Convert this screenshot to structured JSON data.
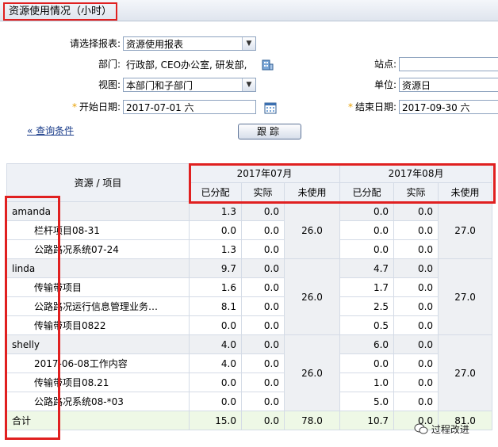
{
  "title": "资源使用情况（小时）",
  "form": {
    "report_label": "请选择报表:",
    "report_value": "资源使用报表",
    "dept_label": "部门:",
    "dept_value": "行政部, CEO办公室, 研发部,",
    "site_label": "站点:",
    "site_value": "",
    "view_label": "视图:",
    "view_value": "本部门和子部门",
    "unit_label": "单位:",
    "unit_value": "资源日",
    "start_label": "开始日期:",
    "start_value": "2017-07-01 六",
    "end_label": "结束日期:",
    "end_value": "2017-09-30 六",
    "query_link": "« 查询条件",
    "track_button": "跟踪"
  },
  "table": {
    "resource_header": "资源 / 项目",
    "months": [
      "2017年07月",
      "2017年08月"
    ],
    "sub_headers": [
      "已分配",
      "实际",
      "未使用"
    ],
    "groups": [
      {
        "name": "amanda",
        "totals": [
          "1.3",
          "0.0",
          "0.0",
          "0.0"
        ],
        "unused": [
          "26.0",
          "27.0"
        ],
        "items": [
          {
            "name": "栏杆项目08-31",
            "values": [
              "0.0",
              "0.0",
              "0.0",
              "0.0"
            ]
          },
          {
            "name": "公路路况系统07-24",
            "values": [
              "1.3",
              "0.0",
              "0.0",
              "0.0"
            ]
          }
        ]
      },
      {
        "name": "linda",
        "totals": [
          "9.7",
          "0.0",
          "4.7",
          "0.0"
        ],
        "unused": [
          "26.0",
          "27.0"
        ],
        "items": [
          {
            "name": "传输带项目",
            "values": [
              "1.6",
              "0.0",
              "1.7",
              "0.0"
            ]
          },
          {
            "name": "公路路况运行信息管理业务…",
            "values": [
              "8.1",
              "0.0",
              "2.5",
              "0.0"
            ]
          },
          {
            "name": "传输带项目0822",
            "values": [
              "0.0",
              "0.0",
              "0.5",
              "0.0"
            ]
          }
        ]
      },
      {
        "name": "shelly",
        "totals": [
          "4.0",
          "0.0",
          "6.0",
          "0.0"
        ],
        "unused": [
          "26.0",
          "27.0"
        ],
        "items": [
          {
            "name": "2017-06-08工作内容",
            "values": [
              "4.0",
              "0.0",
              "0.0",
              "0.0"
            ]
          },
          {
            "name": "传输带项目08.21",
            "values": [
              "0.0",
              "0.0",
              "1.0",
              "0.0"
            ]
          },
          {
            "name": "公路路况系统08-*03",
            "values": [
              "0.0",
              "0.0",
              "5.0",
              "0.0"
            ]
          }
        ]
      }
    ],
    "total": {
      "label": "合计",
      "values": [
        "15.0",
        "0.0",
        "78.0",
        "10.7",
        "0.0",
        "81.0"
      ]
    }
  },
  "watermark": "过程改进",
  "colors": {
    "highlight": "#e02020",
    "accent_star": "#e8a000",
    "link": "#1a3c8a"
  }
}
